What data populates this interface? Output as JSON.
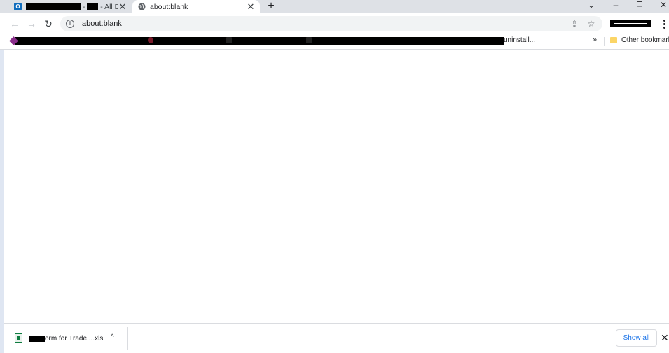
{
  "tabs": [
    {
      "title_suffix": "- All Do",
      "title_mid": "-",
      "active": false,
      "favicon": "outlook-icon"
    },
    {
      "title": "about:blank",
      "active": true,
      "favicon": "globe-icon"
    }
  ],
  "tabstrip": {
    "new_tab": "+"
  },
  "window_controls": {
    "search_tabs": "⌄",
    "minimize": "–",
    "restore": "❐",
    "close": "✕"
  },
  "toolbar": {
    "back": "←",
    "forward": "→",
    "reload": "↻",
    "url": "about:blank",
    "share_icon": "⇪",
    "star_icon": "☆"
  },
  "bookmarks": {
    "visible_text": "uninstall...",
    "more": "»",
    "other_label": "Other bookmarks"
  },
  "downloads": {
    "file_name": "orm for Trade....xls",
    "show_all": "Show all",
    "close": "✕",
    "chevron": "^"
  },
  "colors": {
    "tabstrip_bg": "#dee1e6",
    "accent": "#1a73e8",
    "excel_green": "#107c41"
  }
}
